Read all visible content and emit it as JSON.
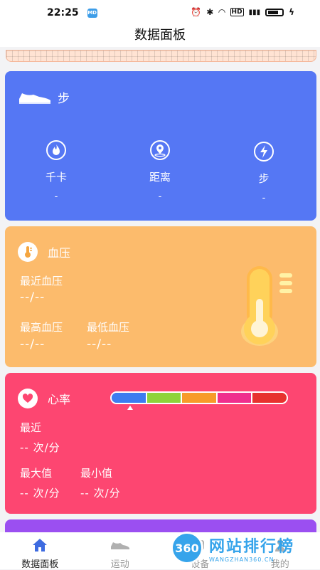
{
  "status": {
    "time": "22:25",
    "app_badge": "MD"
  },
  "header": {
    "title": "数据面板"
  },
  "steps_card": {
    "title": "步",
    "metrics": [
      {
        "label": "千卡",
        "value": "-"
      },
      {
        "label": "距离",
        "value": "-"
      },
      {
        "label": "步",
        "value": "-"
      }
    ]
  },
  "bp_card": {
    "title": "血压",
    "recent_label": "最近血压",
    "recent_value": "--/--",
    "max_label": "最高血压",
    "max_value": "--/--",
    "min_label": "最低血压",
    "min_value": "--/--"
  },
  "hr_card": {
    "title": "心率",
    "recent_label": "最近",
    "recent_value": "-- 次/分",
    "max_label": "最大值",
    "max_value": "-- 次/分",
    "min_label": "最小值",
    "min_value": "-- 次/分",
    "zone_colors": [
      "#3d7cf0",
      "#8ed33a",
      "#f79b2a",
      "#ef2f8d",
      "#e7312e"
    ]
  },
  "tabs": [
    {
      "label": "数据面板",
      "active": true
    },
    {
      "label": "运动",
      "active": false
    },
    {
      "label": "设备",
      "active": false
    },
    {
      "label": "我的",
      "active": false
    }
  ],
  "watermark": {
    "badge": "360",
    "main": "网站排行榜",
    "sub": "WANGZHAN360.CN"
  },
  "colors": {
    "steps": "#5577f4",
    "blood_pressure": "#fcbb6c",
    "heart_rate": "#fd4671",
    "next_card": "#9b4ff1",
    "accent_blue": "#2ca0ea"
  }
}
